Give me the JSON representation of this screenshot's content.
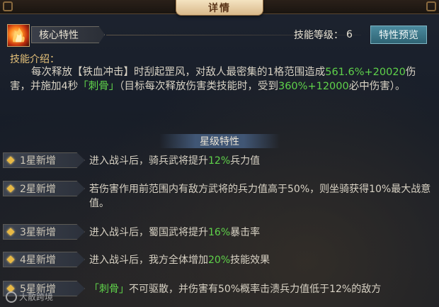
{
  "window": {
    "title": "详情"
  },
  "skill": {
    "icon": "flame-skill-icon",
    "tag": "核心特性",
    "level_label": "技能等级：",
    "level_value": "6",
    "preview_button": "特性预览"
  },
  "intro": {
    "title": "技能介绍：",
    "p1": "每次释放【铁血冲击】时刮起罡风，对敌人最密集的1格范围造成",
    "v1": "561.6%+20020",
    "p2": "伤害，并施加4秒",
    "v2": "「刺骨」",
    "p3": "（目标每次释放伤害类技能时，受到",
    "v3": "360%+12000",
    "p4": "必中伤害）。"
  },
  "stars": {
    "title": "星级特性",
    "rows": [
      {
        "label": "1星新增",
        "pre": "进入战斗后，骑兵武将提升",
        "hl": "12%",
        "post": "兵力值"
      },
      {
        "label": "2星新增",
        "pre": "若伤害作用前范围内有敌方武将的兵力值高于50%，则坐骑获得10%最大战意值。",
        "hl": "",
        "post": ""
      },
      {
        "label": "3星新增",
        "pre": "进入战斗后，蜀国武将提升",
        "hl": "16%",
        "post": "暴击率"
      },
      {
        "label": "4星新增",
        "pre": "进入战斗后，我方全体增加",
        "hl": "20%",
        "post": "技能效果"
      },
      {
        "label": "5星新增",
        "pre": "",
        "hl": "「刺骨」",
        "post": "不可驱散，并伤害有50%概率击溃兵力值低于12%的敌方"
      }
    ]
  },
  "watermark": {
    "text": "大散跨境"
  },
  "colors": {
    "highlight": "#5fd24a",
    "accent": "#e6c27a",
    "button": "#3d7a8c"
  }
}
